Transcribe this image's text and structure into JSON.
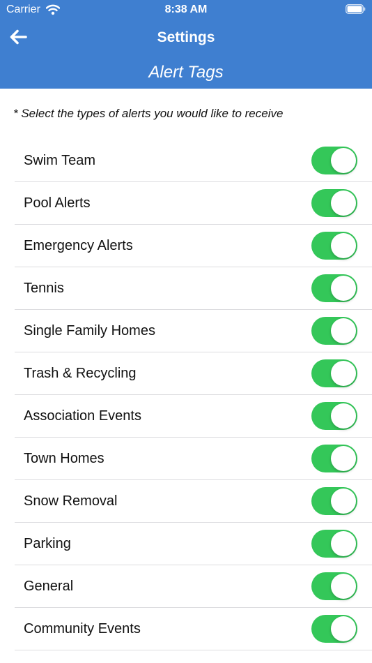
{
  "status_bar": {
    "carrier": "Carrier",
    "time": "8:38 AM"
  },
  "nav": {
    "title": "Settings",
    "back_icon": "arrow-left-icon"
  },
  "subtitle": "Alert Tags",
  "instruction": "* Select the types of alerts you would like to receive",
  "colors": {
    "header": "#3f7fd0",
    "toggle_on": "#34c759"
  },
  "alert_tags": [
    {
      "label": "Swim Team",
      "enabled": true
    },
    {
      "label": "Pool Alerts",
      "enabled": true
    },
    {
      "label": "Emergency Alerts",
      "enabled": true
    },
    {
      "label": "Tennis",
      "enabled": true
    },
    {
      "label": "Single Family Homes",
      "enabled": true
    },
    {
      "label": "Trash & Recycling",
      "enabled": true
    },
    {
      "label": "Association Events",
      "enabled": true
    },
    {
      "label": "Town Homes",
      "enabled": true
    },
    {
      "label": "Snow Removal",
      "enabled": true
    },
    {
      "label": "Parking",
      "enabled": true
    },
    {
      "label": "General",
      "enabled": true
    },
    {
      "label": "Community Events",
      "enabled": true
    }
  ]
}
